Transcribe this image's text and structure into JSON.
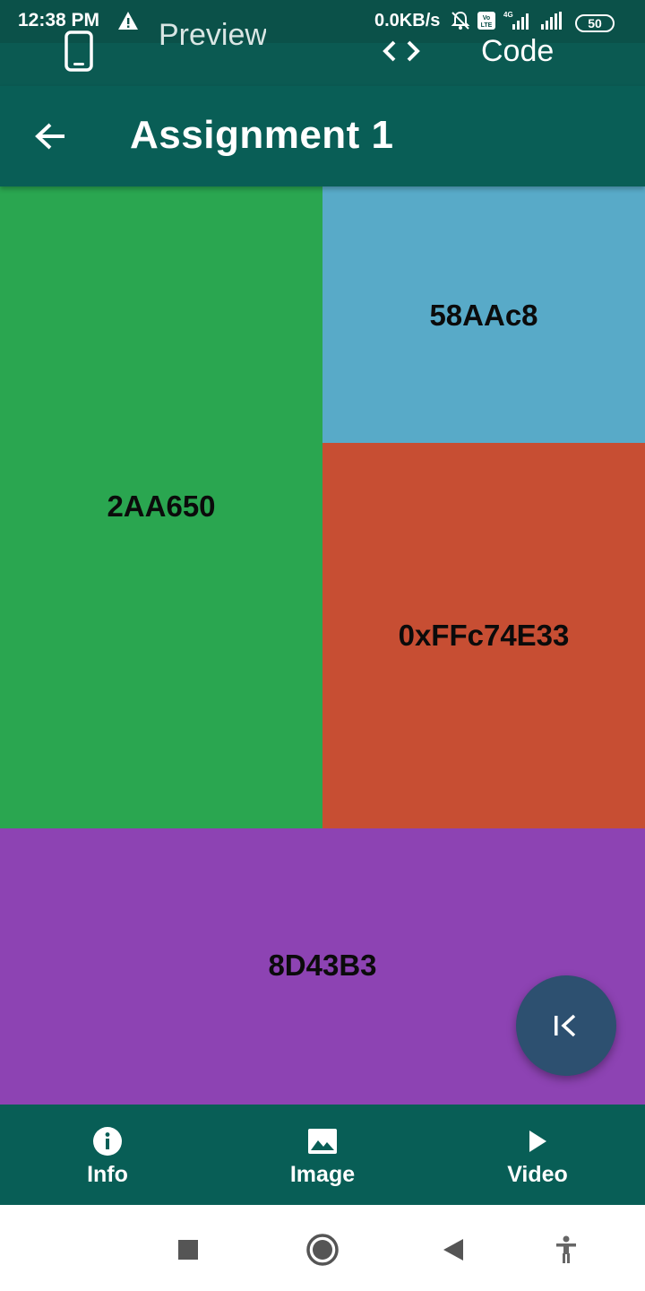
{
  "status_bar": {
    "time": "12:38 PM",
    "network_speed": "0.0KB/s",
    "battery": "50",
    "icons": [
      "warning-icon",
      "mute-bell-icon",
      "volte-icon",
      "signal-4g-icon",
      "signal-icon",
      "battery-icon"
    ]
  },
  "tabs": {
    "preview_label": "Preview",
    "code_label": "Code"
  },
  "app_bar": {
    "title": "Assignment 1"
  },
  "tiles": {
    "green": {
      "label": "2AA650",
      "color": "#2aa650"
    },
    "blue": {
      "label": "58AAc8",
      "color": "#58aac8"
    },
    "red": {
      "label": "0xFFc74E33",
      "color": "#c74e33"
    },
    "purple": {
      "label": "8D43B3",
      "color": "#8d43b3"
    }
  },
  "bottom_nav": {
    "items": [
      {
        "label": "Info",
        "icon": "info-icon"
      },
      {
        "label": "Image",
        "icon": "image-icon"
      },
      {
        "label": "Video",
        "icon": "play-icon"
      }
    ]
  },
  "colors": {
    "primary_dark": "#095e56",
    "fab": "#2d5070"
  }
}
